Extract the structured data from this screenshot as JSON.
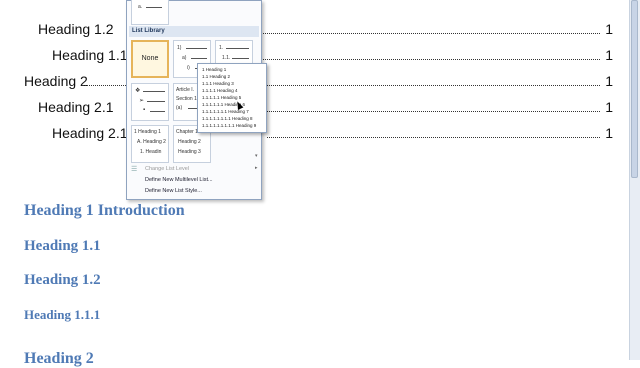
{
  "toc": [
    {
      "text": "Heading 1.2",
      "page": "1"
    },
    {
      "text": "Heading 1.1.1",
      "page": "1"
    },
    {
      "text": "Heading 2",
      "page": "1"
    },
    {
      "text": "Heading 2.1",
      "page": "1"
    },
    {
      "text": "Heading 2.1.1",
      "page": "1"
    }
  ],
  "headings": [
    "Heading 1 Introduction",
    "Heading 1.1",
    "Heading 1.2",
    "Heading 1.1.1",
    "Heading 2"
  ],
  "colors": {
    "heading": "#4f7ab5",
    "menu_border": "#8fa3bf",
    "selected_tile": "#e6b45a"
  },
  "menu": {
    "section_label": "List Library",
    "none_label": "None",
    "tile_text": {
      "top_a": "a.",
      "num1": "1)",
      "num_a": "a)",
      "num_i": "i)",
      "dec1": "1.",
      "dec11": "1.1.",
      "art": "Article I.",
      "sec": "Section 1.",
      "a_paren": "(a)",
      "heading_label": "Heading",
      "h1": "1 Heading 1",
      "h2": "A. Heading 2",
      "h3": "1. Headin",
      "chapter": "Chapter 1",
      "hd2": "Heading 2",
      "hd3": "Heading 3"
    },
    "items": [
      {
        "label": "Change List Level",
        "disabled": true
      },
      {
        "label": "Define New Multilevel List...",
        "disabled": false
      },
      {
        "label": "Define New List Style...",
        "disabled": false
      }
    ]
  },
  "popup_lines": [
    "1 Heading 1",
    "1.1 Heading 2",
    "1.1.1 Heading 3",
    "1.1.1.1 Heading 4",
    "1.1.1.1.1 Heading 5",
    "1.1.1.1.1.1 Heading 6",
    "1.1.1.1.1.1.1 Heading 7",
    "1.1.1.1.1.1.1.1 Heading 8",
    "1.1.1.1.1.1.1.1.1 Heading 9"
  ]
}
